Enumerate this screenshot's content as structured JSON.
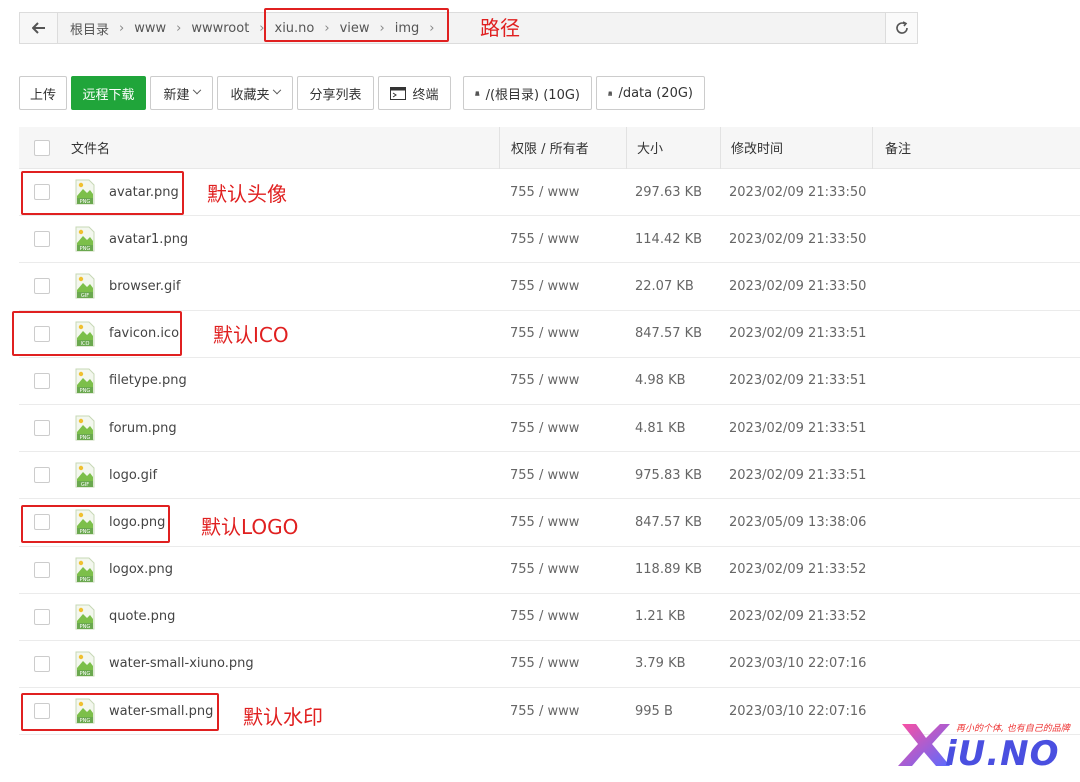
{
  "path": {
    "crumbs": [
      "根目录",
      "www",
      "wwwroot",
      "xiu.no",
      "view",
      "img"
    ],
    "annotation": "路径"
  },
  "toolbar": {
    "upload": "上传",
    "remote_download": "远程下载",
    "new": "新建",
    "favorites": "收藏夹",
    "share_list": "分享列表",
    "terminal": "终端",
    "disk_root": "/(根目录) (10G)",
    "disk_data": "/data (20G)"
  },
  "table": {
    "headers": {
      "name": "文件名",
      "perm": "权限 / 所有者",
      "size": "大小",
      "mtime": "修改时间",
      "note": "备注"
    },
    "rows": [
      {
        "name": "avatar.png",
        "type": "PNG",
        "perm": "755 / www",
        "size": "297.63 KB",
        "mtime": "2023/02/09 21:33:50",
        "annotation": "默认头像"
      },
      {
        "name": "avatar1.png",
        "type": "PNG",
        "perm": "755 / www",
        "size": "114.42 KB",
        "mtime": "2023/02/09 21:33:50",
        "annotation": ""
      },
      {
        "name": "browser.gif",
        "type": "GIF",
        "perm": "755 / www",
        "size": "22.07 KB",
        "mtime": "2023/02/09 21:33:50",
        "annotation": ""
      },
      {
        "name": "favicon.ico",
        "type": "ICO",
        "perm": "755 / www",
        "size": "847.57 KB",
        "mtime": "2023/02/09 21:33:51",
        "annotation": "默认ICO"
      },
      {
        "name": "filetype.png",
        "type": "PNG",
        "perm": "755 / www",
        "size": "4.98 KB",
        "mtime": "2023/02/09 21:33:51",
        "annotation": ""
      },
      {
        "name": "forum.png",
        "type": "PNG",
        "perm": "755 / www",
        "size": "4.81 KB",
        "mtime": "2023/02/09 21:33:51",
        "annotation": ""
      },
      {
        "name": "logo.gif",
        "type": "GIF",
        "perm": "755 / www",
        "size": "975.83 KB",
        "mtime": "2023/02/09 21:33:51",
        "annotation": ""
      },
      {
        "name": "logo.png",
        "type": "PNG",
        "perm": "755 / www",
        "size": "847.57 KB",
        "mtime": "2023/05/09 13:38:06",
        "annotation": "默认LOGO"
      },
      {
        "name": "logox.png",
        "type": "PNG",
        "perm": "755 / www",
        "size": "118.89 KB",
        "mtime": "2023/02/09 21:33:52",
        "annotation": ""
      },
      {
        "name": "quote.png",
        "type": "PNG",
        "perm": "755 / www",
        "size": "1.21 KB",
        "mtime": "2023/02/09 21:33:52",
        "annotation": ""
      },
      {
        "name": "water-small-xiuno.png",
        "type": "PNG",
        "perm": "755 / www",
        "size": "3.79 KB",
        "mtime": "2023/03/10 22:07:16",
        "annotation": ""
      },
      {
        "name": "water-small.png",
        "type": "PNG",
        "perm": "755 / www",
        "size": "995 B",
        "mtime": "2023/03/10 22:07:16",
        "annotation": "默认水印"
      }
    ]
  },
  "watermark": {
    "tagline": "再小的个体, 也有自己的品牌",
    "brand": "iU.NO"
  },
  "colors": {
    "accent_green": "#20a53a",
    "annotation_red": "#e02020",
    "brand_blue": "#4a4fe0"
  }
}
